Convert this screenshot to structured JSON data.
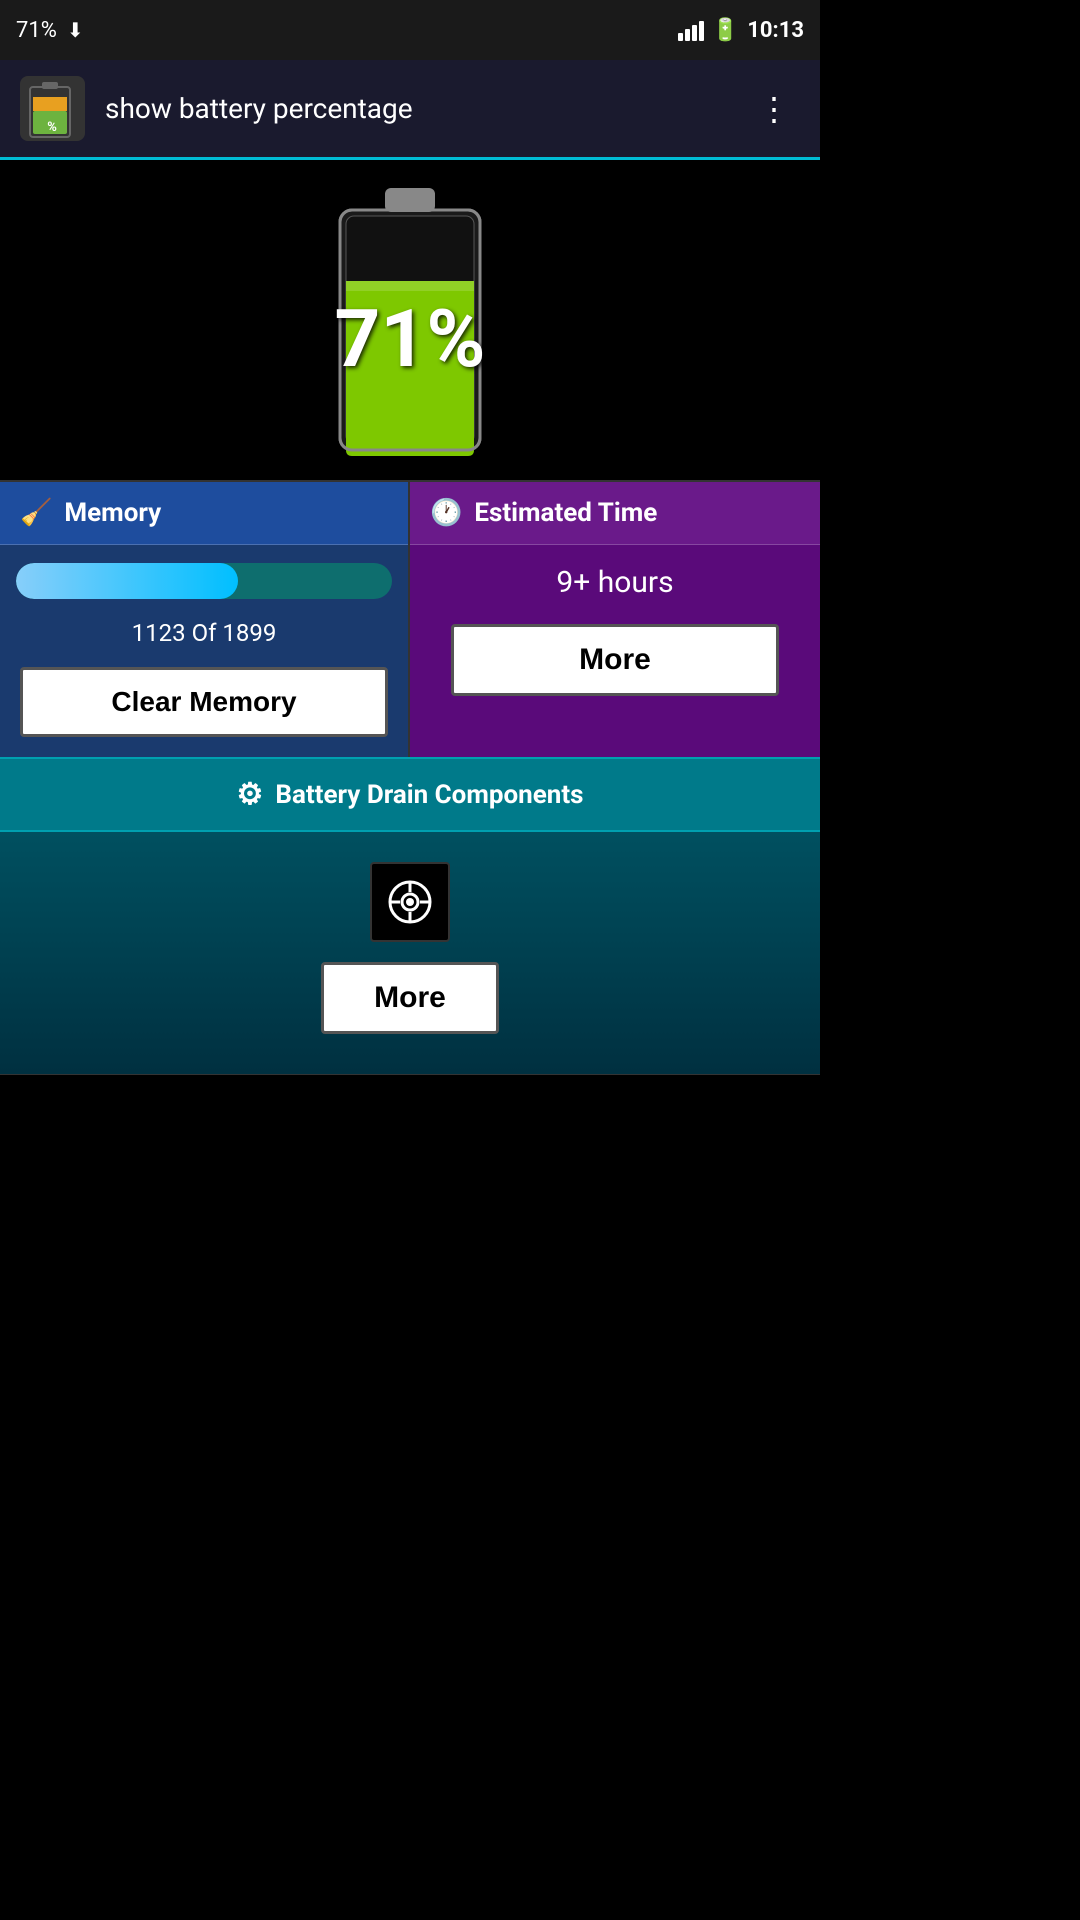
{
  "statusBar": {
    "batteryPercent": "71%",
    "time": "10:13"
  },
  "appBar": {
    "title": "show battery percentage",
    "menuLabel": "⋮"
  },
  "batteryDisplay": {
    "percentage": "71%",
    "fillPercent": 71
  },
  "memoryPanel": {
    "headerLabel": "Memory",
    "progressFill": 59,
    "stats": "1123 Of 1899",
    "clearButtonLabel": "Clear Memory"
  },
  "timePanel": {
    "headerLabel": "Estimated Time",
    "timeValue": "9+ hours",
    "moreButtonLabel": "More"
  },
  "drainSection": {
    "headerLabel": "Battery Drain Components",
    "moreButtonLabel": "More"
  }
}
